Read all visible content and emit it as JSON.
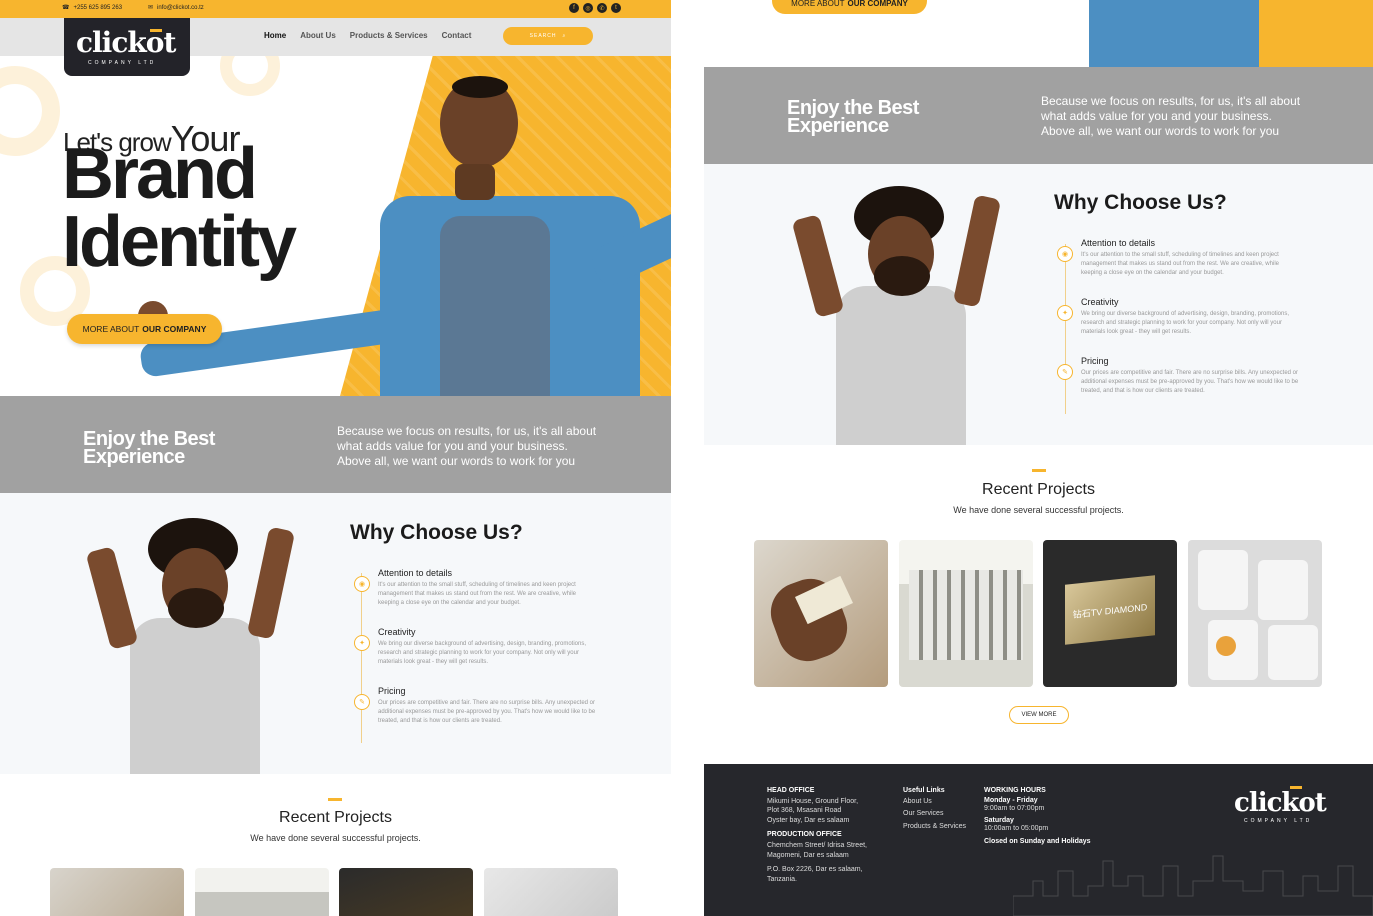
{
  "topbar": {
    "phone": "+255 625 895 263",
    "email": "info@clickot.co.tz"
  },
  "logo": {
    "name": "clickot",
    "sub": "COMPANY LTD"
  },
  "nav": {
    "home": "Home",
    "about": "About Us",
    "products": "Products & Services",
    "contact": "Contact",
    "search_placeholder": "SEARCH"
  },
  "hero": {
    "lets_grow": "Let's grow",
    "your": "Your",
    "brand": "Brand",
    "identity": "Identity",
    "btn_prefix": "MORE ABOUT",
    "btn_bold": "OUR COMPANY"
  },
  "band": {
    "title_line1": "Enjoy the Best",
    "title_line2": "Experience",
    "text": "Because we focus on results, for us, it's all about what adds value for you and your business. Above all, we want our words to work for you"
  },
  "why": {
    "title": "Why Choose Us?",
    "items": [
      {
        "title": "Attention to details",
        "text": "It's our attention to the small stuff, scheduling of timelines and keen project management that makes us stand out from the rest. We are creative, while keeping a close eye on the calendar and your budget."
      },
      {
        "title": "Creativity",
        "text": "We bring our diverse background of advertising, design, branding, promotions, research and strategic planning to work for your company. Not only will your materials look great - they will get results."
      },
      {
        "title": "Pricing",
        "text": "Our prices are competitive and fair. There are no surprise bills. Any unexpected or additional expenses must be pre-approved by you. That's how we would like to be treated, and that is how our clients are treated."
      }
    ]
  },
  "projects": {
    "title": "Recent Projects",
    "subtitle": "We have done several successful projects.",
    "view_more": "VIEW MORE",
    "sign_text": "钻石TV DIAMOND"
  },
  "footer": {
    "head_office_title": "HEAD OFFICE",
    "head_office_l1": "Mikumi House, Ground Floor,",
    "head_office_l2": "Plot 368, Msasani Road",
    "head_office_l3": "Oyster bay, Dar es salaam",
    "production_title": "PRODUCTION OFFICE",
    "production_l1": "Chemchem Street/ Idrisa Street,",
    "production_l2": "Magomeni, Dar es salaam",
    "po_l1": "P.O. Box 2226, Dar es salaam,",
    "po_l2": "Tanzania.",
    "links_title": "Useful Links",
    "link1": "About Us",
    "link2": "Our Services",
    "link3": "Products & Services",
    "hours_title": "WORKING HOURS",
    "days1": "Monday - Friday",
    "hours1": "9:00am to 07:00pm",
    "days2": "Saturday",
    "hours2": "10:00am to 05:00pm",
    "closed": "Closed on Sunday and Holidays"
  },
  "colors": {
    "accent": "#f7b52e",
    "band": "#a1a1a1",
    "footer": "#26272c",
    "dark": "#1b1b1b"
  },
  "icons": [
    "phone-icon",
    "mail-icon",
    "facebook-icon",
    "instagram-icon",
    "whatsapp-icon",
    "twitter-icon",
    "search-icon"
  ]
}
